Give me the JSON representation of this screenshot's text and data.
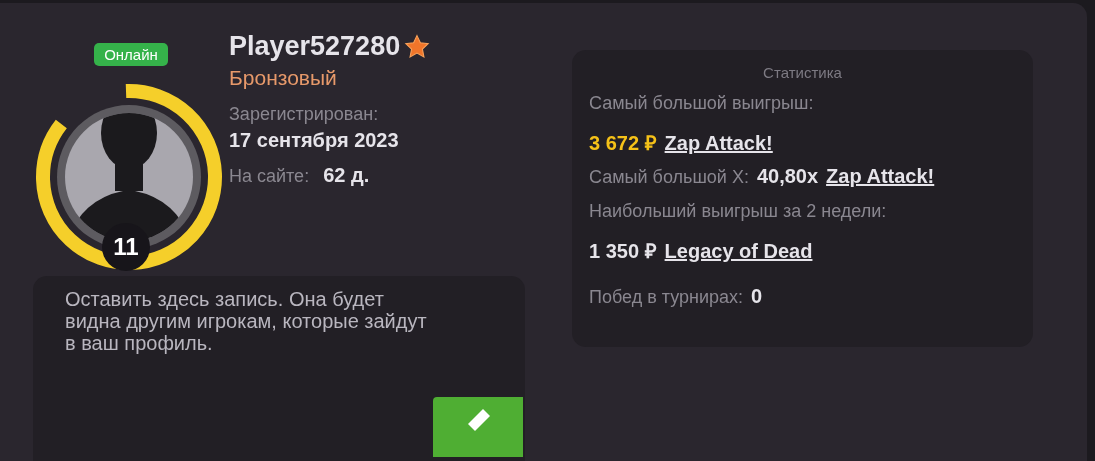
{
  "profile": {
    "status": "Онлайн",
    "online": true,
    "level_number": "11",
    "level": 0.86,
    "name": "Player527280",
    "rank": "Бронзовый",
    "registered_label": "Зарегистрирован:",
    "registered_date": "17 сентября 2023",
    "on_site_label": "На сайте:",
    "on_site_value": "62 д."
  },
  "note": {
    "placeholder": "Оставить здесь запись. Она будет видна другим игрокам, которые зайдут в ваш профиль."
  },
  "stats": {
    "title": "Статистика",
    "items": [
      {
        "kind": "heading",
        "label": "Самый большой выигрыш:"
      },
      {
        "kind": "win",
        "amount": "3 672 ₽",
        "highlighted": true,
        "game": "Zap Attack!"
      },
      {
        "kind": "inline",
        "label": "Самый большой X:",
        "amount": "40,80x",
        "game": "Zap Attack!"
      },
      {
        "kind": "heading",
        "label": "Наибольший выигрыш за 2 недели:"
      },
      {
        "kind": "win",
        "amount": "1 350 ₽",
        "highlighted": false,
        "game": "Legacy of Dead"
      },
      {
        "kind": "inline",
        "label": "Побед в турнирах:",
        "amount": "0"
      }
    ]
  }
}
